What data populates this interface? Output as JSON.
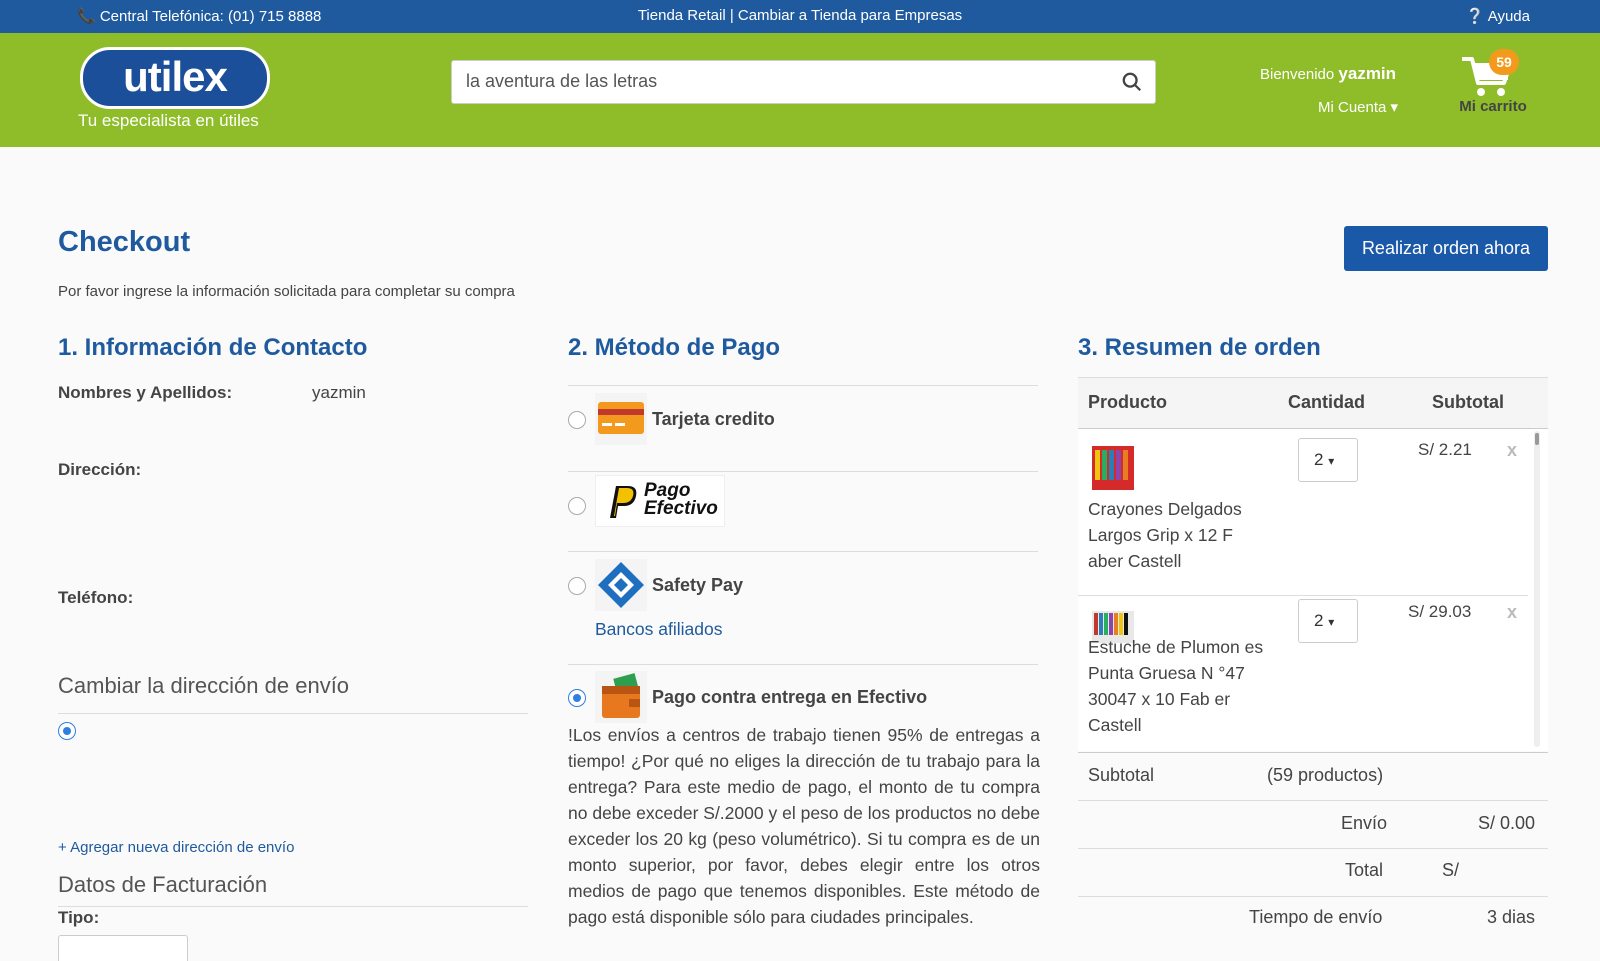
{
  "topbar": {
    "phone": "📞 Central Telefónica: (01) 715 8888",
    "store_switch": "Tienda Retail | Cambiar a Tienda para Empresas",
    "help": "Ayuda"
  },
  "header": {
    "logo_text": "utilex",
    "tagline": "Tu especialista en útiles",
    "search_value": "la aventura de las letras",
    "welcome_prefix": "Bienvenido",
    "user_name": "yazmin",
    "account_label": "Mi Cuenta",
    "cart_count": "59",
    "cart_label": "Mi carrito"
  },
  "page": {
    "title": "Checkout",
    "subtitle": "Por favor ingrese la información solicitada para completar su compra",
    "order_button": "Realizar orden ahora"
  },
  "contact": {
    "title": "1. Información de Contacto",
    "name_label": "Nombres y Apellidos:",
    "name_value": "yazmin",
    "address_label": "Dirección:",
    "phone_label": "Teléfono:",
    "change_address_title": "Cambiar la dirección de envío",
    "add_address_link": "+ Agregar nueva dirección de envío",
    "billing_title": "Datos de Facturación",
    "type_label": "Tipo:"
  },
  "payment": {
    "title": "2. Método de Pago",
    "methods": [
      {
        "label": "Tarjeta credito",
        "icon": "credit-card-icon"
      },
      {
        "label": "Pago Efectivo",
        "icon": "pago-efectivo-logo"
      },
      {
        "label": "Safety Pay",
        "icon": "safety-pay-icon",
        "link": "Bancos afiliados"
      },
      {
        "label": "Pago contra entrega en Efectivo",
        "icon": "wallet-icon",
        "selected": true
      }
    ],
    "pago_efectivo_logo_line1": "Pago",
    "pago_efectivo_logo_line2": "Efectivo",
    "description": "!Los envíos a centros de trabajo tienen 95% de entregas a tiempo! ¿Por qué no eliges la dirección de tu trabajo para la entrega? Para este medio de pago, el monto de tu compra no debe exceder S/.2000 y el peso de los productos no debe exceder los 20 kg (peso volumétrico). Si tu compra es de un monto superior, por favor, debes elegir entre los otros medios de pago que tenemos disponibles. Este método de pago está disponible sólo para ciudades principales."
  },
  "summary": {
    "title": "3. Resumen de orden",
    "col_product": "Producto",
    "col_qty": "Cantidad",
    "col_subtotal": "Subtotal",
    "items": [
      {
        "name": "Crayones Delgados Largos Grip x 12 F aber Castell",
        "qty": "2",
        "price": "S/ 2.21",
        "remove": "x"
      },
      {
        "name": "Estuche de Plumon es Punta Gruesa N °47 30047 x 10 Fab er Castell",
        "qty": "2",
        "price": "S/ 29.03",
        "remove": "x"
      }
    ],
    "subtotal_label": "Subtotal",
    "subtotal_count": "(59 productos)",
    "shipping_label": "Envío",
    "shipping_value": "S/ 0.00",
    "total_label": "Total",
    "total_value": "S/",
    "time_label": "Tiempo de envío",
    "time_value": "3 dias"
  },
  "colors": {
    "topbar": "#1f5a9e",
    "header": "#8fbd2a",
    "accent": "#1f5a9e",
    "cart_badge": "#f29a1b"
  }
}
